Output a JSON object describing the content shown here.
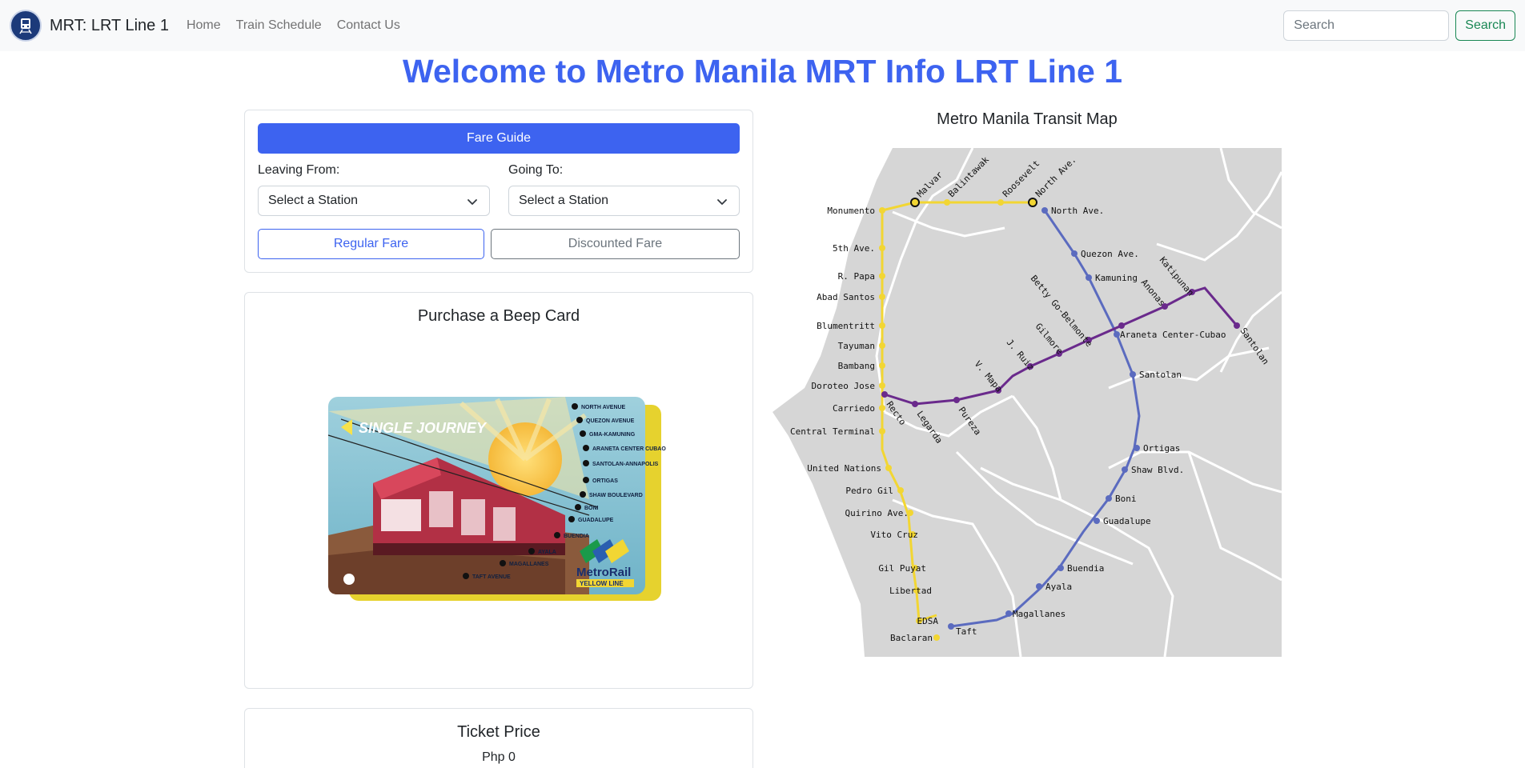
{
  "nav": {
    "brand": "MRT: LRT Line 1",
    "links": [
      "Home",
      "Train Schedule",
      "Contact Us"
    ],
    "search_placeholder": "Search",
    "search_button": "Search"
  },
  "page_title": "Welcome to Metro Manila MRT Info LRT Line 1",
  "fare_guide": {
    "button": "Fare Guide",
    "leaving_label": "Leaving From:",
    "going_label": "Going To:",
    "leaving_value": "Select a Station",
    "going_value": "Select a Station",
    "regular_button": "Regular Fare",
    "discounted_button": "Discounted Fare"
  },
  "beep_card": {
    "heading": "Purchase a Beep Card",
    "card_title": "SINGLE JOURNEY",
    "brand": "MetroRail",
    "brand_line": "YELLOW LINE",
    "stations": [
      "NORTH AVENUE",
      "QUEZON AVENUE",
      "GMA-KAMUNING",
      "ARANETA CENTER CUBAO",
      "SANTOLAN-ANNAPOLIS",
      "ORTIGAS",
      "SHAW BOULEVARD",
      "BONI",
      "GUADALUPE",
      "BUENDIA",
      "AYALA",
      "MAGALLANES",
      "TAFT AVENUE"
    ]
  },
  "ticket": {
    "heading": "Ticket Price",
    "price": "Php 0"
  },
  "map": {
    "title": "Metro Manila Transit Map",
    "colors": {
      "yellow": "#f2d633",
      "blue": "#5b6bbf",
      "purple": "#6a2a8c",
      "land": "#d6d6d6",
      "water": "#ffffff"
    },
    "yellow_line": [
      "Monumento",
      "5th Ave.",
      "R. Papa",
      "Abad Santos",
      "Blumentritt",
      "Tayuman",
      "Bambang",
      "Doroteo Jose",
      "Carriedo",
      "Central Terminal",
      "United Nations",
      "Pedro Gil",
      "Quirino Ave.",
      "Vito Cruz",
      "Gil Puyat",
      "Libertad",
      "EDSA",
      "Baclaran"
    ],
    "yellow_top": [
      "Malvar",
      "Balintawak",
      "Roosevelt",
      "North Ave."
    ],
    "blue_line": [
      "North Ave.",
      "Quezon Ave.",
      "Kamuning",
      "Araneta Center-Cubao",
      "Santolan",
      "Ortigas",
      "Shaw Blvd.",
      "Boni",
      "Guadalupe",
      "Buendia",
      "Ayala",
      "Magallanes",
      "Taft"
    ],
    "purple_line": [
      "Recto",
      "Legarda",
      "Pureza",
      "V. Mapa",
      "J. Ruiz",
      "Gilmore",
      "Betty Go-Belmonte",
      "Anonas",
      "Katipunan",
      "Santolan"
    ]
  }
}
